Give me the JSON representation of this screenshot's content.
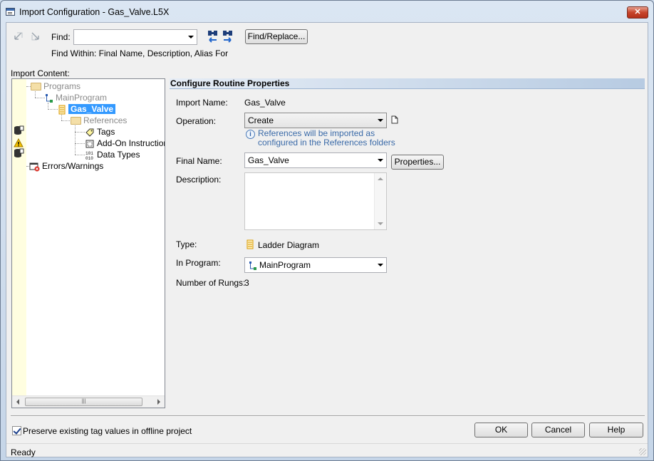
{
  "window": {
    "title": "Import Configuration - Gas_Valve.L5X",
    "close_glyph": "✕"
  },
  "toolbar": {
    "find_label": "Find:",
    "find_value": "",
    "find_replace_label": "Find/Replace...",
    "find_within": "Find Within: Final Name, Description, Alias For"
  },
  "import_content": {
    "label": "Import Content:",
    "tree": {
      "programs": "Programs",
      "main_program": "MainProgram",
      "gas_valve": "Gas_Valve",
      "references": "References",
      "tags": "Tags",
      "aoi": "Add-On Instructions",
      "data_types": "Data Types",
      "errors": "Errors/Warnings"
    },
    "scroll_thumb": "|||"
  },
  "panel": {
    "heading": "Configure Routine Properties",
    "import_name_label": "Import Name:",
    "import_name_value": "Gas_Valve",
    "operation_label": "Operation:",
    "operation_value": "Create",
    "info_line1": "References will be imported as",
    "info_line2": "configured in the References folders",
    "final_name_label": "Final Name:",
    "final_name_value": "Gas_Valve",
    "properties_button": "Properties...",
    "description_label": "Description:",
    "description_value": "",
    "type_label": "Type:",
    "type_value": "Ladder Diagram",
    "in_program_label": "In Program:",
    "in_program_value": "MainProgram",
    "rungs_label": "Number of Rungs:",
    "rungs_value": "3"
  },
  "footer": {
    "preserve_label": "Preserve existing tag values in offline project",
    "preserve_checked": true,
    "ok": "OK",
    "cancel": "Cancel",
    "help": "Help",
    "status": "Ready"
  },
  "icons": {
    "nav_prev": "nav-previous-icon",
    "nav_next": "nav-next-icon",
    "find_up": "binoculars-up-icon",
    "find_down": "binoculars-down-icon"
  },
  "colors": {
    "selection": "#3399ff",
    "info_text": "#3a6aa8",
    "close_button": "#c7442a"
  }
}
